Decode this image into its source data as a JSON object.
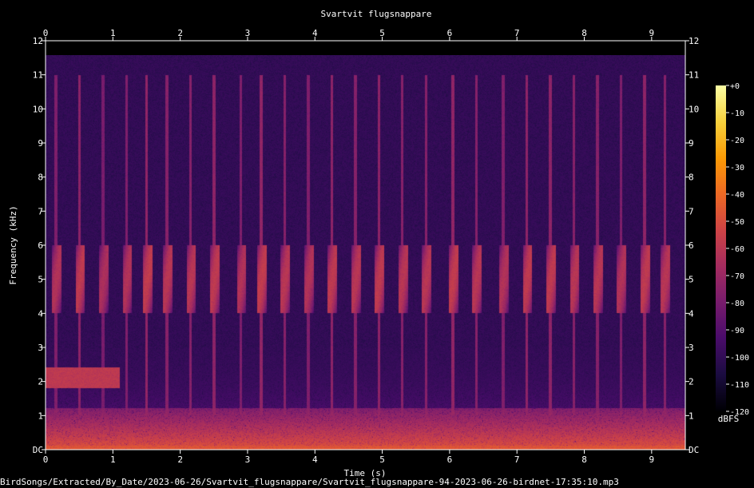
{
  "chart_data": {
    "type": "heatmap",
    "title": "Svartvit flugsnappare",
    "xlabel": "Time (s)",
    "ylabel": "Frequency (kHz)",
    "xlim": [
      0,
      9.5
    ],
    "ylim": [
      0,
      12
    ],
    "x_ticks": [
      "0",
      "1",
      "2",
      "3",
      "4",
      "5",
      "6",
      "7",
      "8",
      "9"
    ],
    "y_ticks": [
      "DC",
      "1",
      "2",
      "3",
      "4",
      "5",
      "6",
      "7",
      "8",
      "9",
      "10",
      "11",
      "12"
    ],
    "colorbar": {
      "label": "dBFS",
      "ticks": [
        "+0",
        "-10",
        "-20",
        "-30",
        "-40",
        "-50",
        "-60",
        "-70",
        "-80",
        "-90",
        "-100",
        "-110",
        "-120"
      ],
      "range": [
        -120,
        0
      ],
      "colors": [
        "#000004",
        "#1b0c41",
        "#4a0c6b",
        "#781c6d",
        "#a52c60",
        "#cf4446",
        "#ed6925",
        "#fb9b06",
        "#f7d13d",
        "#fcffa4"
      ]
    },
    "background_db": -100,
    "low_frequency_energy": {
      "max_khz": 1.2,
      "peak_db": -45
    },
    "sustained_band": {
      "t_start": 0.0,
      "t_end": 1.1,
      "f_low": 1.8,
      "f_high": 2.4,
      "db": -58
    },
    "song_elements": [
      {
        "t": 0.15,
        "db": -62
      },
      {
        "t": 0.5,
        "db": -58
      },
      {
        "t": 0.85,
        "db": -64
      },
      {
        "t": 1.2,
        "db": -62
      },
      {
        "t": 1.5,
        "db": -57
      },
      {
        "t": 1.8,
        "db": -60
      },
      {
        "t": 2.15,
        "db": -60
      },
      {
        "t": 2.5,
        "db": -58
      },
      {
        "t": 2.9,
        "db": -62
      },
      {
        "t": 3.2,
        "db": -57
      },
      {
        "t": 3.55,
        "db": -60
      },
      {
        "t": 3.9,
        "db": -62
      },
      {
        "t": 4.25,
        "db": -58
      },
      {
        "t": 4.6,
        "db": -60
      },
      {
        "t": 4.95,
        "db": -58
      },
      {
        "t": 5.3,
        "db": -60
      },
      {
        "t": 5.65,
        "db": -60
      },
      {
        "t": 6.05,
        "db": -57
      },
      {
        "t": 6.4,
        "db": -60
      },
      {
        "t": 6.8,
        "db": -62
      },
      {
        "t": 7.15,
        "db": -58
      },
      {
        "t": 7.5,
        "db": -58
      },
      {
        "t": 7.85,
        "db": -60
      },
      {
        "t": 8.2,
        "db": -60
      },
      {
        "t": 8.55,
        "db": -62
      },
      {
        "t": 8.9,
        "db": -58
      },
      {
        "t": 9.2,
        "db": -60
      }
    ],
    "song_frequency_khz": [
      4.0,
      6.0
    ],
    "note_center_khz": 4.9
  },
  "caption": "BirdSongs/Extracted/By_Date/2023-06-26/Svartvit_flugsnappare/Svartvit_flugsnappare-94-2023-06-26-birdnet-17:35:10.mp3"
}
